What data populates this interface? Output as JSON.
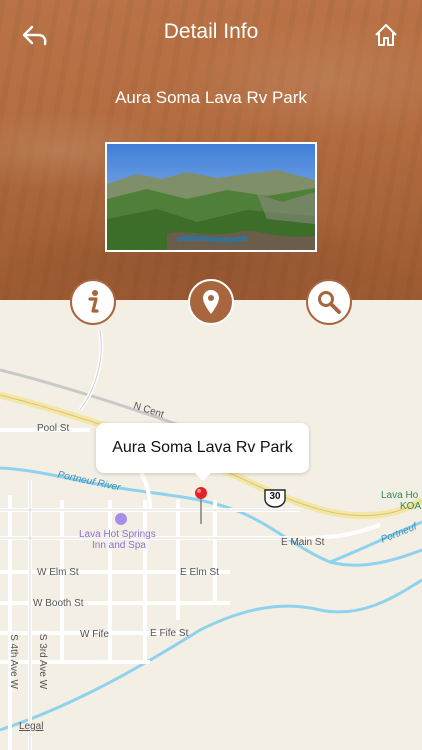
{
  "nav": {
    "title": "Detail Info"
  },
  "place": {
    "name": "Aura Soma Lava Rv Park"
  },
  "map": {
    "callout": "Aura Soma Lava Rv Park",
    "labels": {
      "pool_st": "Pool St",
      "n_cent": "N Cent",
      "portneuf_river": "Portneuf River",
      "portneuf_right": "Portneuf",
      "lava_hot_springs_1": "Lava Hot Springs",
      "lava_hot_springs_2": "Inn and Spa",
      "w_elm": "W Elm St",
      "e_elm": "E Elm St",
      "w_booth": "W Booth St",
      "w_fife": "W Fife",
      "e_fife": "E Fife St",
      "e_main": "E Main St",
      "s_4th": "S 4th Ave W",
      "s_3rd": "S 3rd Ave W",
      "lava_hot_right": "Lava Ho",
      "koa": "KOA",
      "route": "30",
      "legal": "Legal"
    }
  },
  "colors": {
    "accent": "#a8653e",
    "header": "#b36d40"
  }
}
